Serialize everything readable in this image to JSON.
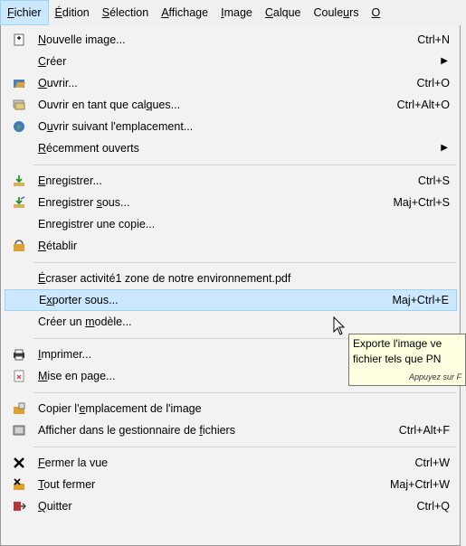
{
  "menubar": [
    {
      "pre": "",
      "u": "F",
      "post": "ichier",
      "active": true
    },
    {
      "pre": "",
      "u": "É",
      "post": "dition"
    },
    {
      "pre": "",
      "u": "S",
      "post": "élection"
    },
    {
      "pre": "",
      "u": "A",
      "post": "ffichage"
    },
    {
      "pre": "",
      "u": "I",
      "post": "mage"
    },
    {
      "pre": "",
      "u": "C",
      "post": "alque"
    },
    {
      "pre": "Coule",
      "u": "u",
      "post": "rs"
    },
    {
      "pre": "",
      "u": "O",
      "post": ""
    }
  ],
  "menu": {
    "items": [
      {
        "pre": "",
        "u": "N",
        "post": "ouvelle image...",
        "shortcut": "Ctrl+N",
        "icon": "new-image-icon"
      },
      {
        "pre": "",
        "u": "C",
        "post": "réer",
        "submenu": true
      },
      {
        "pre": "",
        "u": "O",
        "post": "uvrir...",
        "shortcut": "Ctrl+O",
        "icon": "open-folder-icon"
      },
      {
        "pre": "Ouvrir en tant que cal",
        "u": "q",
        "post": "ues...",
        "shortcut": "Ctrl+Alt+O",
        "icon": "open-as-layers-icon"
      },
      {
        "pre": "O",
        "u": "u",
        "post": "vrir suivant l'emplacement...",
        "icon": "globe-icon"
      },
      {
        "pre": "",
        "u": "R",
        "post": "écemment ouverts",
        "submenu": true
      },
      {
        "pre": "",
        "u": "E",
        "post": "nregistrer...",
        "shortcut": "Ctrl+S",
        "icon": "save-icon"
      },
      {
        "pre": "Enregistrer ",
        "u": "s",
        "post": "ous...",
        "shortcut": "Maj+Ctrl+S",
        "icon": "save-as-icon"
      },
      {
        "pre": "Enregistrer une copie...",
        "u": "",
        "post": ""
      },
      {
        "pre": "",
        "u": "R",
        "post": "établir",
        "icon": "revert-icon"
      },
      {
        "pre": "",
        "u": "É",
        "post": "craser activité1 zone de notre environnement.pdf"
      },
      {
        "pre": "E",
        "u": "x",
        "post": "porter sous...",
        "shortcut": "Maj+Ctrl+E",
        "highlighted": true
      },
      {
        "pre": "Créer un ",
        "u": "m",
        "post": "odèle..."
      },
      {
        "pre": "",
        "u": "I",
        "post": "mprimer...",
        "icon": "printer-icon"
      },
      {
        "pre": "",
        "u": "M",
        "post": "ise en page...",
        "icon": "page-setup-icon"
      },
      {
        "pre": "Copier l'",
        "u": "e",
        "post": "mplacement de l'image",
        "icon": "copy-location-icon"
      },
      {
        "pre": "Afficher dans le gestionnaire de ",
        "u": "f",
        "post": "ichiers",
        "shortcut": "Ctrl+Alt+F",
        "icon": "file-manager-icon"
      },
      {
        "pre": "",
        "u": "F",
        "post": "ermer la vue",
        "shortcut": "Ctrl+W",
        "icon": "close-icon"
      },
      {
        "pre": "",
        "u": "T",
        "post": "out fermer",
        "shortcut": "Maj+Ctrl+W",
        "icon": "close-all-icon"
      },
      {
        "pre": "",
        "u": "Q",
        "post": "uitter",
        "shortcut": "Ctrl+Q",
        "icon": "quit-icon"
      }
    ]
  },
  "tooltip": {
    "line1": "Exporte l'image ve",
    "line2": "fichier tels que PN",
    "hint": "Appuyez sur F"
  }
}
